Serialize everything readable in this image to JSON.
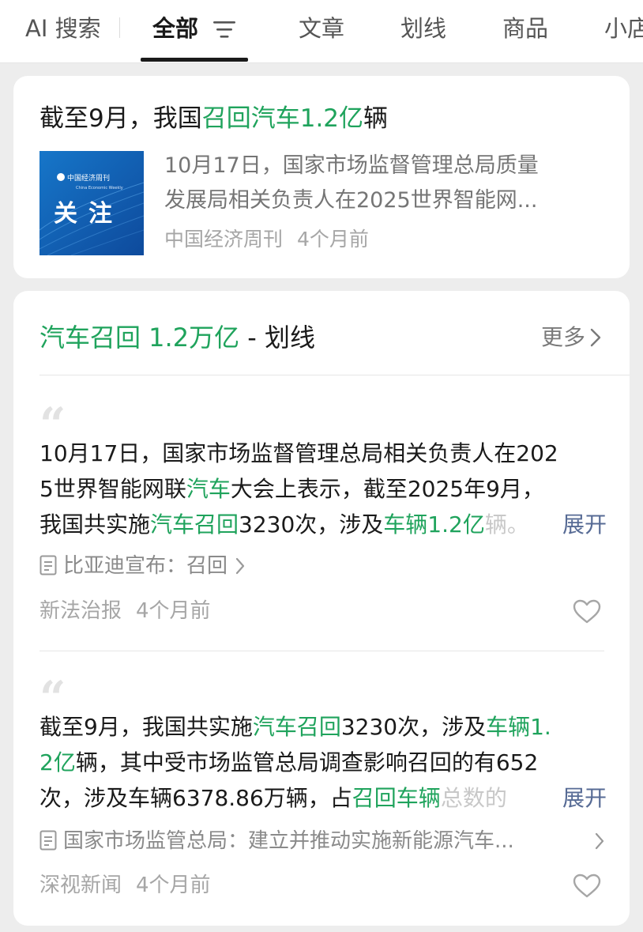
{
  "tabs": {
    "ai_search": "AI 搜索",
    "all": "全部",
    "articles": "文章",
    "highlights": "划线",
    "products": "商品",
    "stores": "小店"
  },
  "article": {
    "title_pre": "截至9月，我国",
    "title_hl": "召回汽车1.2亿",
    "title_post": "辆",
    "thumb_logo": "中国经济周刊",
    "thumb_logo_en": "China Economic Weekly",
    "thumb_text": "关注",
    "summary_line1": "10月17日，国家市场监督管理总局质量",
    "summary_line2": "发展局相关负责人在2025世界智能网...",
    "source": "中国经济周刊",
    "time": "4个月前"
  },
  "section": {
    "title_hl": "汽车召回 1.2万亿",
    "title_rest": " - 划线",
    "more": "更多"
  },
  "highlights": [
    {
      "l1": "10月17日，国家市场监督管理总局相关负责人在202",
      "l2a": "5世界智能网联",
      "l2b": "汽车",
      "l2c": "大会上表示，截至2025年9月，",
      "l3a": "我国共实施",
      "l3b": "汽车召回",
      "l3c": "3230次，涉及",
      "l3d": "车辆1.2亿",
      "l3e": "辆。",
      "expand": "展开",
      "link": "比亚迪宣布：召回",
      "source": "新法治报",
      "time": "4个月前"
    },
    {
      "l1a": "截至9月，我国共实施",
      "l1b": "汽车召回",
      "l1c": "3230次，涉及",
      "l1d": "车辆1.",
      "l2a": "2亿",
      "l2b": "辆，其中受市场监管总局调查影响召回的有652",
      "l3a": "次，涉及车辆6378.86万辆，占",
      "l3b": "召回车辆",
      "l3c": "总数的",
      "expand": "展开",
      "link": "国家市场监管总局：建立并推动实施新能源汽车...",
      "source": "深视新闻",
      "time": "4个月前"
    }
  ],
  "colors": {
    "highlight": "#1fa35c",
    "link": "#576b95"
  }
}
